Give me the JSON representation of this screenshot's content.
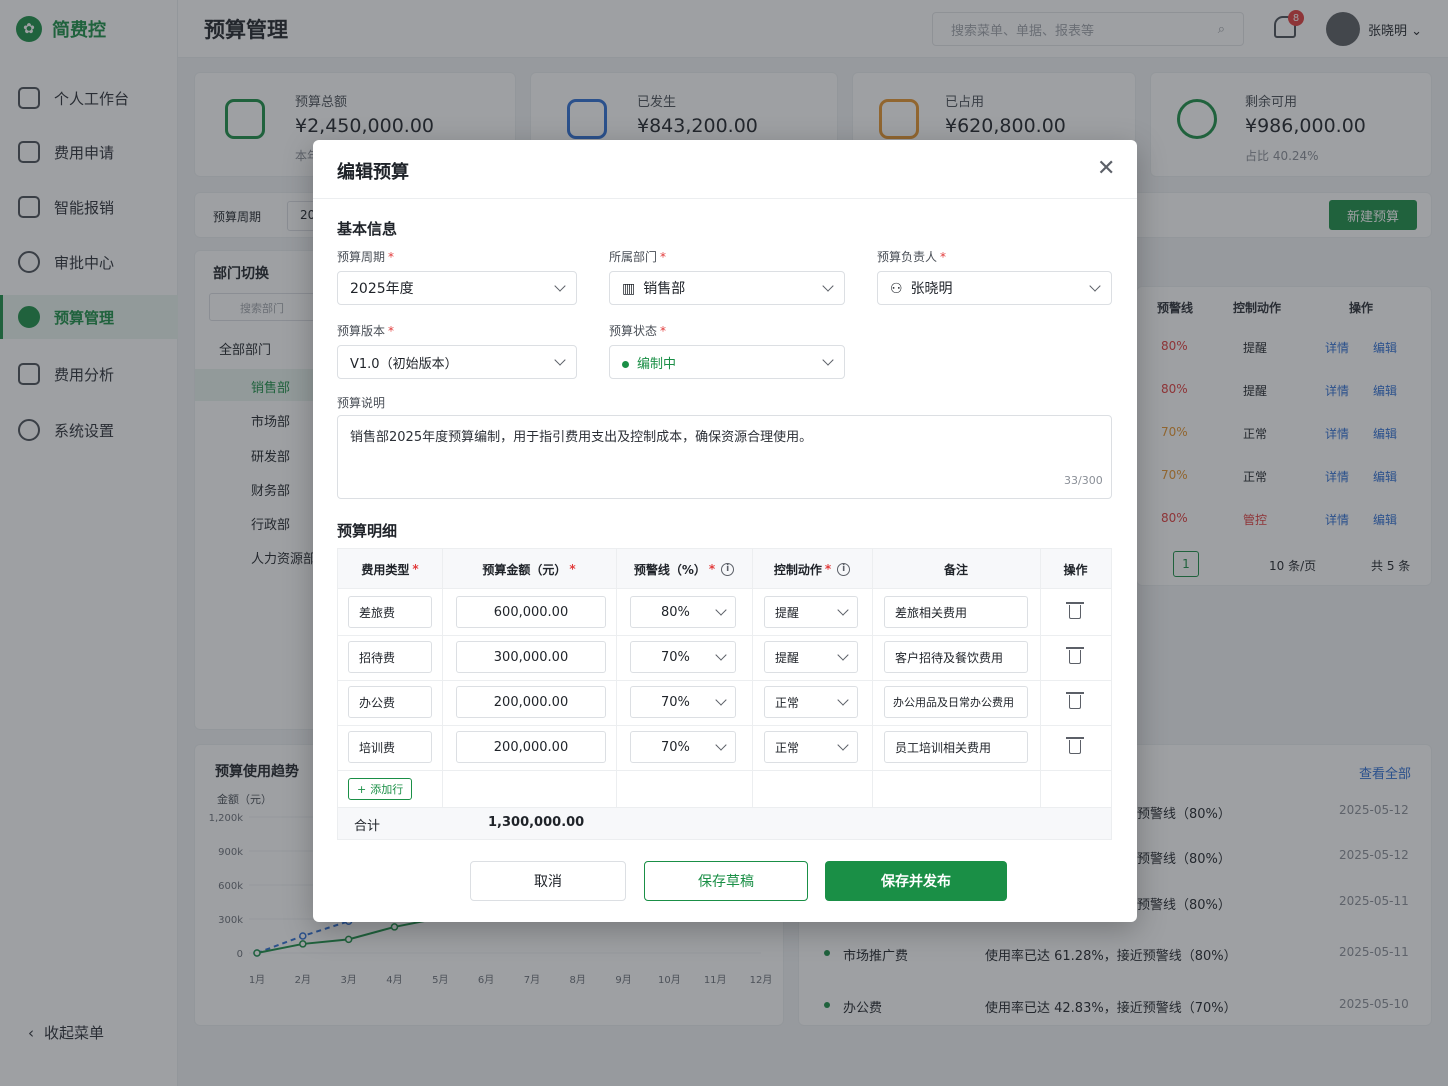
{
  "app": {
    "logo_text": "简费控",
    "page_title": "预算管理"
  },
  "nav": {
    "items": [
      {
        "label": "个人工作台",
        "icon": "home-icon"
      },
      {
        "label": "费用申请",
        "icon": "document-icon"
      },
      {
        "label": "智能报销",
        "icon": "wallet-icon"
      },
      {
        "label": "审批中心",
        "icon": "user-icon"
      },
      {
        "label": "预算管理",
        "icon": "pie-chart-icon",
        "active": true
      },
      {
        "label": "费用分析",
        "icon": "bar-chart-icon"
      },
      {
        "label": "系统设置",
        "icon": "gear-icon"
      }
    ],
    "collapse_label": "收起菜单"
  },
  "header": {
    "search_placeholder": "搜索菜单、单据、报表等",
    "notifications": "8",
    "user_name": "张晓明"
  },
  "stats": [
    {
      "label": "预算总额",
      "value": "¥2,450,000.00",
      "sub": "本年"
    },
    {
      "label": "已发生",
      "value": "¥843,200.00"
    },
    {
      "label": "已占用",
      "value": "¥620,800.00"
    },
    {
      "label": "剩余可用",
      "value": "¥986,000.00",
      "sub": "占比 40.24%"
    }
  ],
  "filter": {
    "period_label": "预算周期",
    "period_value": "20",
    "new_button": "新建预算"
  },
  "dept": {
    "title": "部门切换",
    "search_placeholder": "搜索部门",
    "items": [
      "全部部门",
      "销售部",
      "市场部",
      "研发部",
      "财务部",
      "行政部",
      "人力资源部"
    ]
  },
  "bg_table": {
    "headers": [
      "预警线",
      "控制动作",
      "操作"
    ],
    "rows": [
      {
        "line": "80%",
        "action": "提醒",
        "detail": "详情",
        "edit": "编辑"
      },
      {
        "line": "80%",
        "action": "提醒",
        "detail": "详情",
        "edit": "编辑"
      },
      {
        "line": "70%",
        "action": "正常",
        "detail": "详情",
        "edit": "编辑"
      },
      {
        "line": "70%",
        "action": "正常",
        "detail": "详情",
        "edit": "编辑"
      },
      {
        "line": "80%",
        "action": "管控",
        "detail": "详情",
        "edit": "编辑"
      }
    ],
    "page": "1",
    "page_size": "10 条/页",
    "total": "共 5 条"
  },
  "trend": {
    "title": "预算使用趋势",
    "unit": "金额（元）"
  },
  "chart_data": {
    "type": "line",
    "categories": [
      "1月",
      "2月",
      "3月",
      "4月",
      "5月",
      "6月",
      "7月",
      "8月",
      "9月",
      "10月",
      "11月",
      "12月"
    ],
    "y_ticks": [
      "1,200k",
      "900k",
      "600k",
      "300k",
      "0"
    ],
    "ylim": [
      0,
      1200
    ],
    "series": [
      {
        "values": [
          0,
          150,
          280,
          320,
          380
        ],
        "color": "#2f6fd6",
        "dashed": true
      },
      {
        "values": [
          0,
          80,
          120,
          230,
          310
        ],
        "color": "#1a8f46",
        "dashed": false
      }
    ]
  },
  "alerts": {
    "view_all": "查看全部",
    "items": [
      {
        "name": "",
        "msg": "预警线（80%）",
        "date": "2025-05-12"
      },
      {
        "name": "",
        "msg": "预警线（80%）",
        "date": "2025-05-12"
      },
      {
        "name": "",
        "msg": "预警线（80%）",
        "date": "2025-05-11"
      },
      {
        "name": "市场推广费",
        "msg": "使用率已达 61.28%，接近预警线（80%）",
        "date": "2025-05-11"
      },
      {
        "name": "办公费",
        "msg": "使用率已达 42.83%，接近预警线（70%）",
        "date": "2025-05-10"
      }
    ]
  },
  "modal": {
    "title": "编辑预算",
    "basic_title": "基本信息",
    "period_label": "预算周期",
    "period_value": "2025年度",
    "dept_label": "所属部门",
    "dept_value": "销售部",
    "owner_label": "预算负责人",
    "owner_value": "张晓明",
    "version_label": "预算版本",
    "version_value": "V1.0（初始版本）",
    "status_label": "预算状态",
    "status_value": "编制中",
    "desc_label": "预算说明",
    "desc_value": "销售部2025年度预算编制，用于指引费用支出及控制成本，确保资源合理使用。",
    "desc_counter": "33/300",
    "detail_title": "预算明细",
    "columns": [
      "费用类型",
      "预算金额（元）",
      "预警线（%）",
      "控制动作",
      "备注",
      "操作"
    ],
    "rows": [
      {
        "type": "差旅费",
        "amount": "600,000.00",
        "line": "80%",
        "action": "提醒",
        "note": "差旅相关费用"
      },
      {
        "type": "招待费",
        "amount": "300,000.00",
        "line": "70%",
        "action": "提醒",
        "note": "客户招待及餐饮费用"
      },
      {
        "type": "办公费",
        "amount": "200,000.00",
        "line": "70%",
        "action": "正常",
        "note": "办公用品及日常办公费用"
      },
      {
        "type": "培训费",
        "amount": "200,000.00",
        "line": "70%",
        "action": "正常",
        "note": "员工培训相关费用"
      }
    ],
    "add_row": "添加行",
    "total_label": "合计",
    "total_value": "1,300,000.00",
    "cancel": "取消",
    "save_draft": "保存草稿",
    "save_publish": "保存并发布"
  }
}
